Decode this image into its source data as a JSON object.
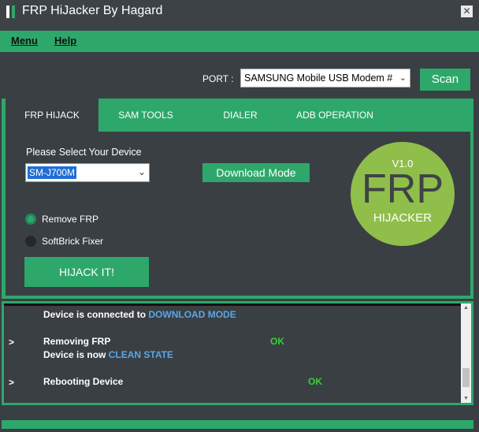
{
  "window": {
    "title": "FRP HiJacker By Hagard",
    "close_label": "✕"
  },
  "menu": {
    "items": [
      {
        "label": "Menu"
      },
      {
        "label": "Help"
      }
    ]
  },
  "port": {
    "label": "PORT :",
    "selected": "SAMSUNG Mobile USB Modem #",
    "scan_label": "Scan"
  },
  "tabs": [
    {
      "label": "FRP HIJACK"
    },
    {
      "label": "SAM TOOLS"
    },
    {
      "label": "DIALER"
    },
    {
      "label": "ADB OPERATION"
    }
  ],
  "device": {
    "label": "Please Select Your Device",
    "selected": "SM-J700M",
    "download_mode_label": "Download Mode"
  },
  "options": [
    {
      "label": "Remove FRP",
      "checked": true
    },
    {
      "label": "SoftBrick Fixer",
      "checked": false
    }
  ],
  "hijack_button": "HIJACK IT!",
  "logo": {
    "version": "V1.0",
    "frp": "FRP",
    "sub": "HIJACKER"
  },
  "log": {
    "line1": {
      "text": "Device is connected to",
      "accent": "DOWNLOAD MODE"
    },
    "line2": {
      "prompt": ">",
      "text": "Removing FRP",
      "status": "OK"
    },
    "line3": {
      "text": "Device is now",
      "accent": "CLEAN STATE"
    },
    "line4": {
      "prompt": ">",
      "text": "Rebooting Device",
      "status": "OK"
    }
  },
  "colors": {
    "accent": "#2ea86a",
    "background": "#3a3f44",
    "log_highlight": "#5aa6e6",
    "ok": "#31d431",
    "logo": "#8fbf4a"
  },
  "icons": {
    "select_arrow": "chevron-down-icon",
    "close": "close-icon"
  }
}
